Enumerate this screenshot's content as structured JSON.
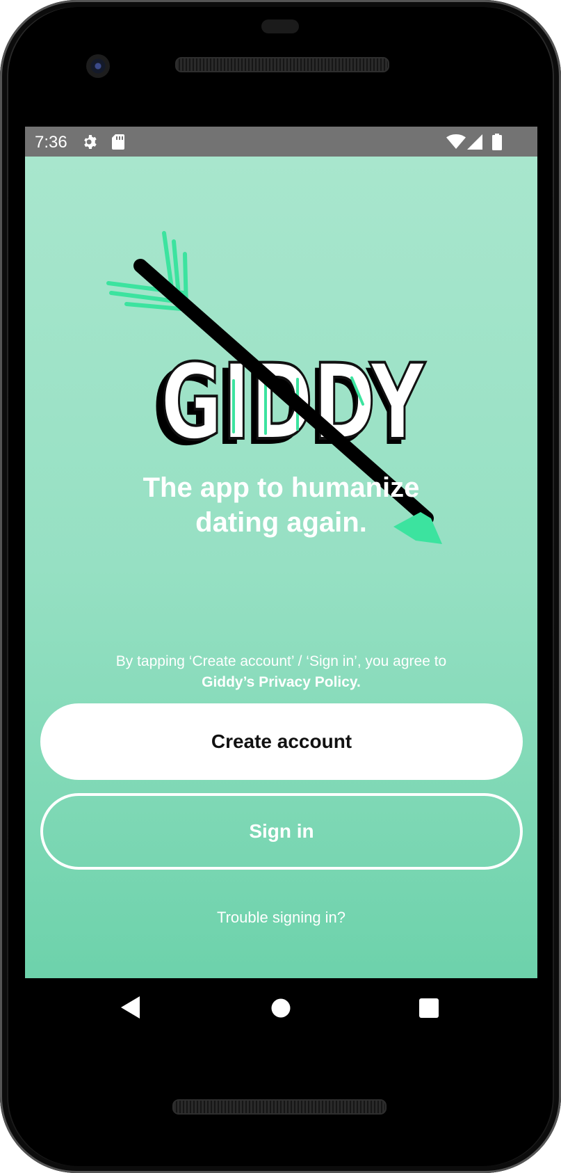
{
  "status_bar": {
    "time": "7:36",
    "left_icons": [
      "gear-icon",
      "sd-card-icon"
    ],
    "right_icons": [
      "wifi-icon",
      "cell-signal-icon",
      "battery-icon"
    ]
  },
  "logo": {
    "text": "GIDDY",
    "icon": "arrow-icon"
  },
  "tagline": {
    "line1": "The app to humanize",
    "line2": "dating again."
  },
  "legal": {
    "line1": "By tapping ‘Create account’ / ‘Sign in’, you agree to",
    "policy_link": "Giddy’s Privacy Policy."
  },
  "buttons": {
    "create_account": "Create account",
    "sign_in": "Sign in"
  },
  "trouble_link": "Trouble signing in?",
  "nav_bar": {
    "back": "back-icon",
    "home": "home-icon",
    "recents": "recents-icon"
  },
  "colors": {
    "background_top": "#a8e6cd",
    "background_bottom": "#6dd2ab",
    "accent_green": "#3ce39f",
    "status_bar": "#737373",
    "button_fill": "#ffffff"
  }
}
